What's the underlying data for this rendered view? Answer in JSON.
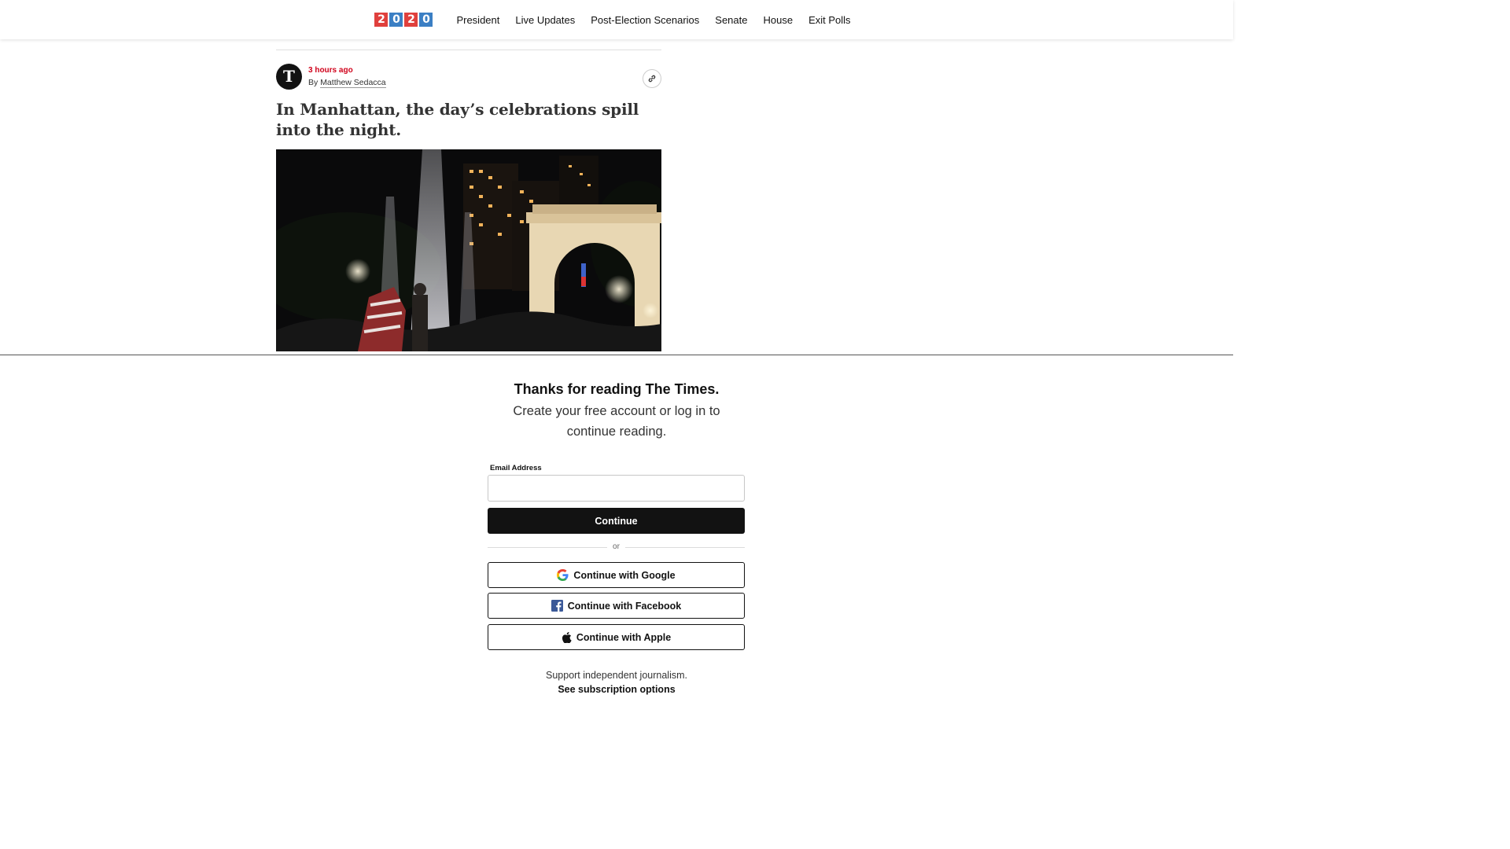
{
  "nav": {
    "logo_digits": [
      "2",
      "0",
      "2",
      "0"
    ],
    "logo_colors": [
      "#e0403d",
      "#3b7fc4",
      "#e0403d",
      "#3b7fc4"
    ],
    "links": [
      "President",
      "Live Updates",
      "Post-Election Scenarios",
      "Senate",
      "House",
      "Exit Polls"
    ]
  },
  "article": {
    "timestamp": "3 hours ago",
    "by_prefix": "By",
    "author": "Matthew Sedacca",
    "avatar_glyph": "T",
    "headline": "In Manhattan, the day’s celebrations spill into the night."
  },
  "paywall": {
    "title": "Thanks for reading The Times.",
    "subtitle": "Create your free account or log in to continue reading.",
    "email_label": "Email Address",
    "email_value": "",
    "continue_label": "Continue",
    "or_label": "or",
    "google_label": "Continue with Google",
    "facebook_label": "Continue with Facebook",
    "apple_label": "Continue with Apple",
    "support_text": "Support independent journalism.",
    "subscription_link": "See subscription options"
  },
  "colors": {
    "timestamp": "#d0021b",
    "facebook": "#3b5998"
  }
}
